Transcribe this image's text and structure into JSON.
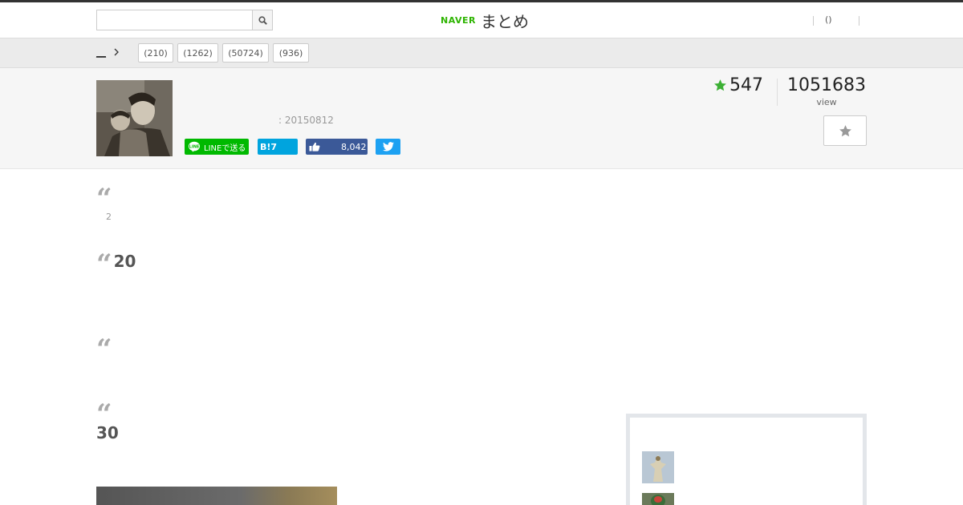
{
  "header": {
    "search": {
      "value": "",
      "placeholder": ""
    },
    "logo": {
      "naver": "NAVER",
      "matome": "まとめ"
    },
    "user_link": "()"
  },
  "catbar": {
    "home": "__",
    "tags": [
      "(210)",
      "(1262)",
      "(50724)",
      "(936)"
    ]
  },
  "article": {
    "date": ": 20150812",
    "favorites": "547",
    "views": "1051683",
    "views_label": "view",
    "share": {
      "line": "LINEで送る",
      "hatena": "B!7",
      "facebook_count": "8,042"
    }
  },
  "content": {
    "small_num": "2",
    "quotes": [
      "",
      "20",
      "",
      ""
    ],
    "heading_30": "30"
  },
  "colors": {
    "naver_green": "#2db400",
    "line_green": "#00b900",
    "hatena_blue": "#00a4de",
    "facebook_blue": "#3b5998",
    "twitter_blue": "#1da1f2",
    "star_green": "#3cb034"
  }
}
